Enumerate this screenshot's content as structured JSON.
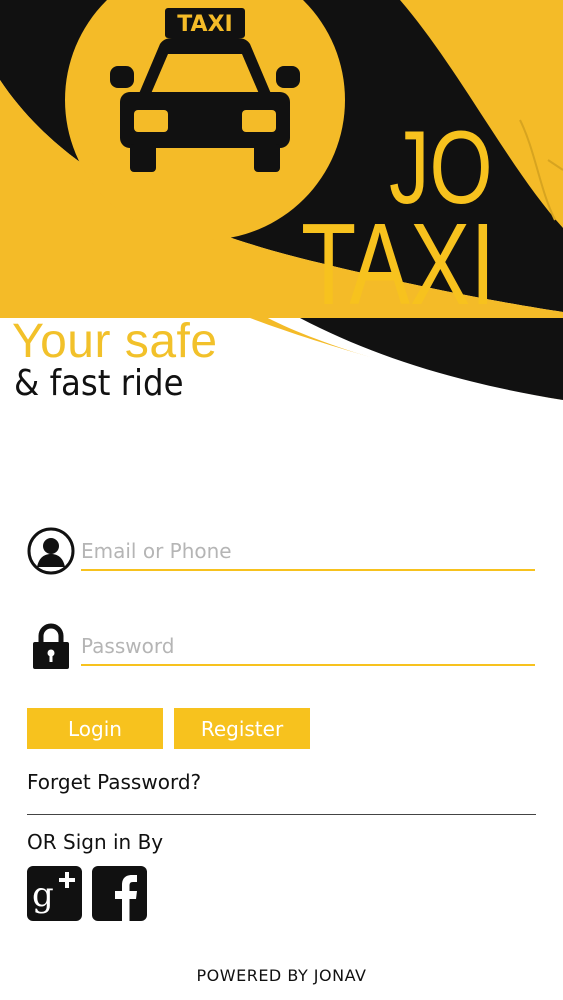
{
  "brand": {
    "badge": "TAXI",
    "line1": "JO",
    "line2": "TAXI"
  },
  "tagline": {
    "line1": "Your safe",
    "line2": "& fast ride"
  },
  "login_form": {
    "email_placeholder": "Email or Phone",
    "password_placeholder": "Password",
    "login_label": "Login",
    "register_label": "Register",
    "forgot_label": "Forget Password?"
  },
  "social": {
    "heading": "OR Sign in By",
    "google_icon": "google-plus-icon",
    "facebook_icon": "facebook-icon"
  },
  "footer": {
    "text": "POWERED BY JONAV"
  },
  "colors": {
    "accent": "#f7c21e",
    "dark": "#111111"
  }
}
